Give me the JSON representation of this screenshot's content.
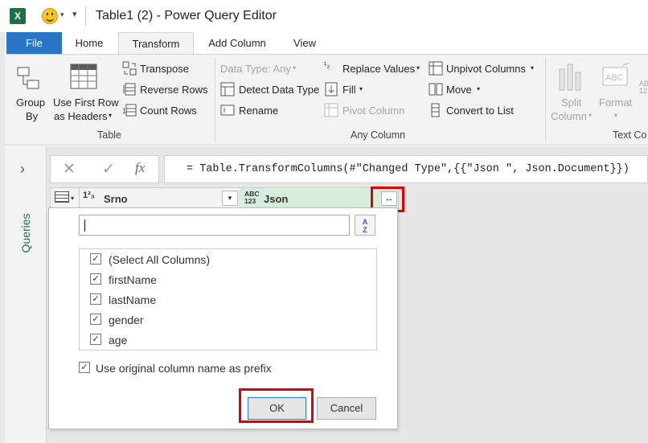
{
  "window": {
    "title": "Table1 (2) - Power Query Editor",
    "app_icon": "X",
    "qat_more": "▾"
  },
  "tabs": [
    {
      "label": "File"
    },
    {
      "label": "Home"
    },
    {
      "label": "Transform",
      "active": true
    },
    {
      "label": "Add Column"
    },
    {
      "label": "View"
    }
  ],
  "ribbon": {
    "table_group": {
      "label": "Table",
      "group_by": [
        "Group",
        "By"
      ],
      "use_first_row": [
        "Use First Row",
        "as Headers"
      ],
      "transpose": "Transpose",
      "reverse_rows": "Reverse Rows",
      "count_rows": "Count Rows"
    },
    "any_column_group": {
      "label": "Any Column",
      "data_type": "Data Type: Any",
      "detect_data_type": "Detect Data Type",
      "rename": "Rename",
      "replace_values": "Replace Values",
      "fill": "Fill",
      "pivot_column": "Pivot Column",
      "unpivot_columns": "Unpivot Columns",
      "move": "Move",
      "convert_to_list": "Convert to List"
    },
    "text_column_group": {
      "label": "Text Co",
      "split_column": [
        "Split",
        "Column"
      ],
      "format": "Format"
    }
  },
  "left_panel": {
    "label": "Queries",
    "chevron": "›"
  },
  "formula_bar": {
    "cancel_icon": "✕",
    "commit_icon": "✓",
    "fx_icon": "fx",
    "formula": "= Table.TransformColumns(#\"Changed Type\",{{\"Json \", Json.Document}})"
  },
  "grid": {
    "columns": [
      {
        "type_label": "1²₃",
        "name": "Srno"
      },
      {
        "type_label_top": "ABC",
        "type_label_bottom": "123",
        "name": "Json"
      }
    ],
    "expand_icon": "↔"
  },
  "expand_popup": {
    "search_placeholder": "",
    "sort_icon_top": "A",
    "sort_icon_bottom": "Z",
    "columns": [
      {
        "label": "(Select All Columns)",
        "checked": true
      },
      {
        "label": "firstName",
        "checked": true
      },
      {
        "label": "lastName",
        "checked": true
      },
      {
        "label": "gender",
        "checked": true
      },
      {
        "label": "age",
        "checked": true
      }
    ],
    "prefix_option": {
      "label": "Use original column name as prefix",
      "checked": true
    },
    "ok_label": "OK",
    "cancel_label": "Cancel"
  },
  "colors": {
    "file_tab": "#2b75c7",
    "excel_green": "#1e7145",
    "queries_green": "#217346",
    "json_header_bg": "#d7eedc",
    "highlight_red": "#e00000"
  }
}
